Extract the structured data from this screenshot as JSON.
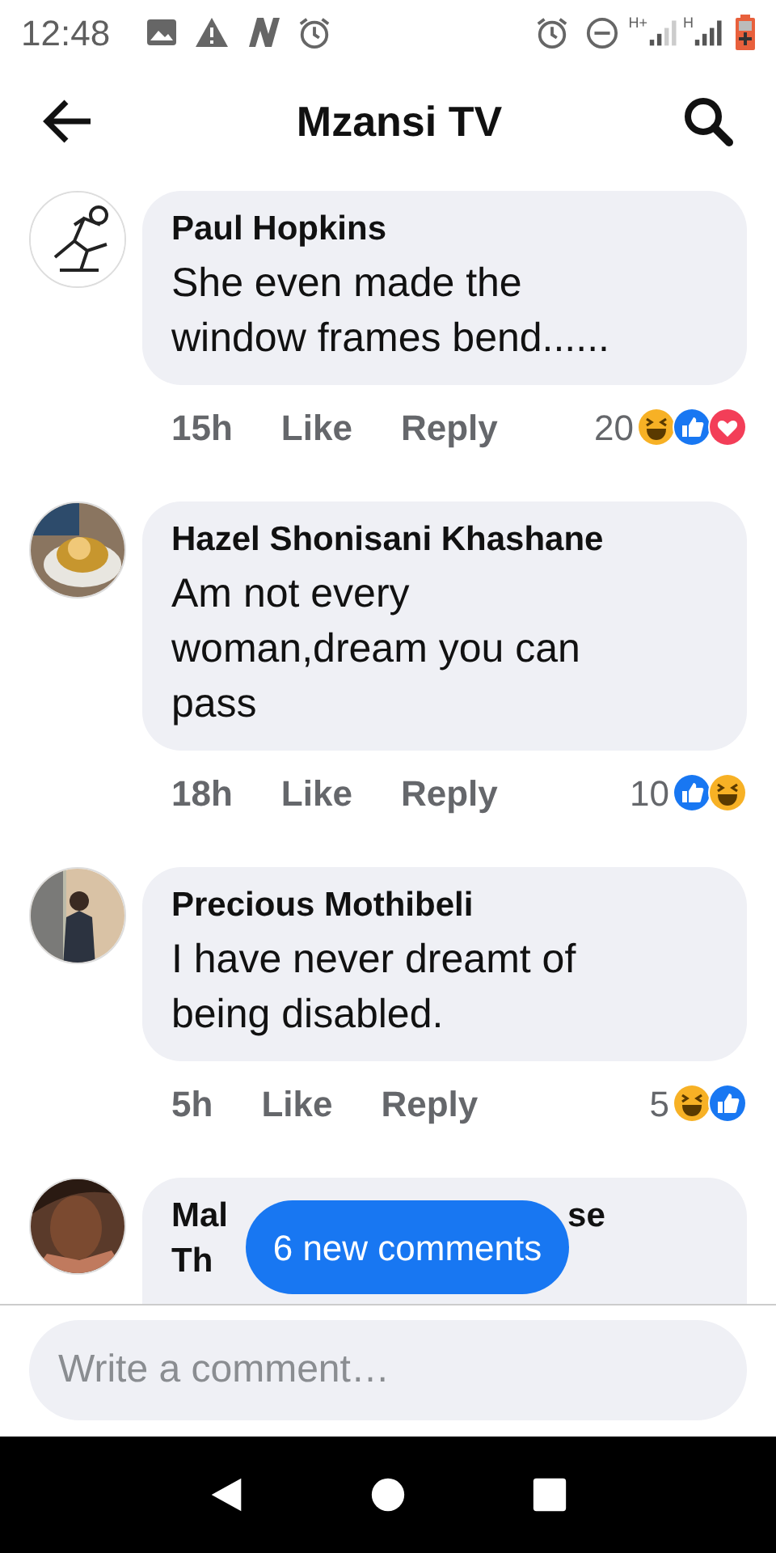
{
  "status_bar": {
    "time": "12:48",
    "network_labels": [
      "H+",
      "H"
    ]
  },
  "header": {
    "title": "Mzansi TV"
  },
  "comments": [
    {
      "name": "Paul Hopkins",
      "text": "She even made the window frames bend......",
      "time": "15h",
      "like": "Like",
      "reply": "Reply",
      "reaction_count": "20",
      "reactions": [
        {
          "kind": "haha"
        },
        {
          "kind": "like"
        },
        {
          "kind": "love"
        }
      ],
      "avatar": {
        "kind": "picture"
      }
    },
    {
      "name": "Hazel Shonisani Khashane",
      "text": "Am not every woman,dream you can pass",
      "time": "18h",
      "like": "Like",
      "reply": "Reply",
      "reaction_count": "10",
      "reactions": [
        {
          "kind": "like"
        },
        {
          "kind": "haha"
        }
      ],
      "avatar": {
        "kind": "picture"
      }
    },
    {
      "name": "Precious Mothibeli",
      "text": "I have never dreamt of being disabled.",
      "time": "5h",
      "like": "Like",
      "reply": "Reply",
      "reaction_count": "5",
      "reactions": [
        {
          "kind": "haha"
        },
        {
          "kind": "like"
        }
      ],
      "avatar": {
        "kind": "picture"
      }
    },
    {
      "name_parts": [
        "Mal",
        "se",
        "Th"
      ],
      "avatar": {
        "kind": "picture"
      }
    }
  ],
  "new_comments_button": "6 new comments",
  "comment_field": {
    "placeholder": "Write a comment…"
  }
}
